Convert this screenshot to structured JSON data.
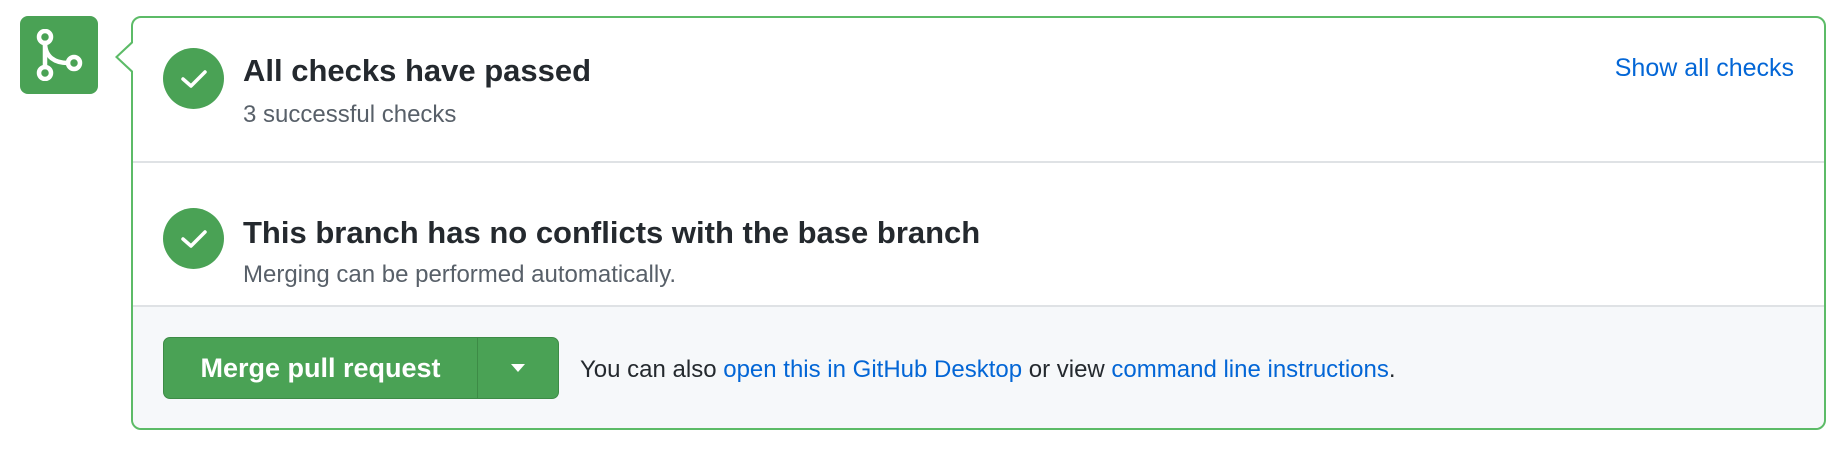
{
  "merge_icon": {
    "icon": "git-merge-icon",
    "color": "#4aa255"
  },
  "checks": {
    "icon": "check-icon",
    "title": "All checks have passed",
    "subtitle": "3 successful checks",
    "show_all_label": "Show all checks"
  },
  "conflicts": {
    "icon": "check-icon",
    "title": "This branch has no conflicts with the base branch",
    "subtitle": "Merging can be performed automatically."
  },
  "merge": {
    "button_label": "Merge pull request",
    "dropdown_icon": "caret-down-icon",
    "help_prefix": "You can also ",
    "desktop_link": "open this in GitHub Desktop",
    "help_middle": " or view ",
    "cli_link": "command line instructions",
    "help_suffix": "."
  },
  "colors": {
    "success": "#4aa255",
    "border": "#5cbb67",
    "link": "#0366d6",
    "text": "#24292e",
    "muted": "#586069"
  }
}
